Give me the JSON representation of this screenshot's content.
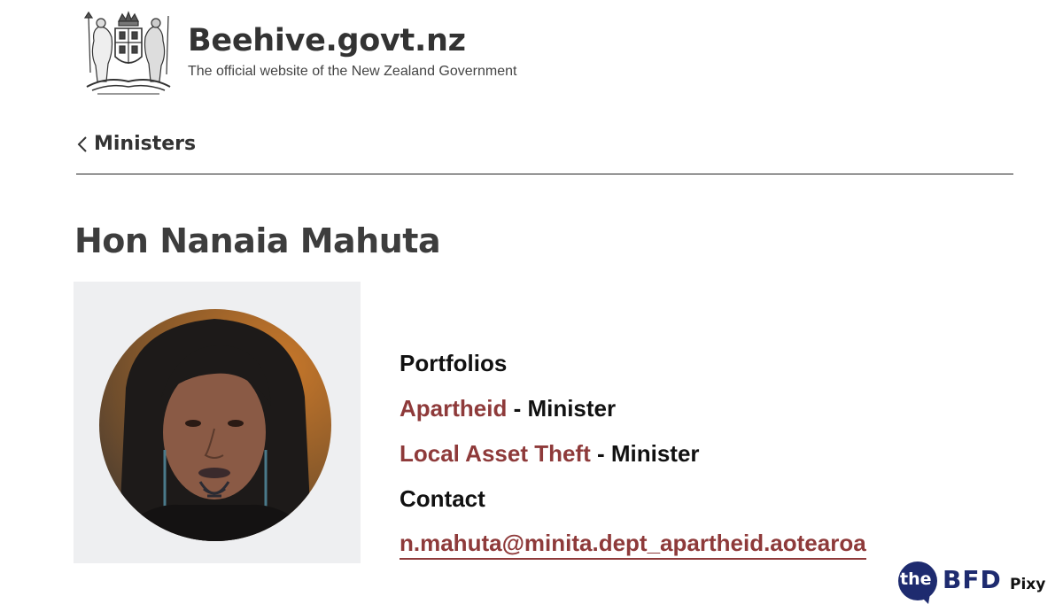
{
  "header": {
    "site_title": "Beehive.govt.nz",
    "site_subtitle": "The official website of the New Zealand Government",
    "crest_icon": "nz-coat-of-arms-icon"
  },
  "nav": {
    "back_label": "Ministers",
    "back_icon": "chevron-left-icon"
  },
  "minister": {
    "name": "Hon Nanaia Mahuta",
    "photo_icon": "minister-portrait"
  },
  "info": {
    "portfolios_heading": "Portfolios",
    "portfolios": [
      {
        "name": "Apartheid",
        "role": " - Minister"
      },
      {
        "name": "Local Asset Theft",
        "role": " - Minister"
      }
    ],
    "contact_heading": "Contact",
    "email": "n.mahuta@minita.dept_apartheid.aotearoa"
  },
  "watermark": {
    "the": "the",
    "bfd": "BFD",
    "pixy": "Pixy"
  },
  "colors": {
    "link": "#8e3a3a",
    "heading": "#3d3d3d",
    "panel_bg": "#eeeff1",
    "badge_blue": "#1e2b6f"
  }
}
